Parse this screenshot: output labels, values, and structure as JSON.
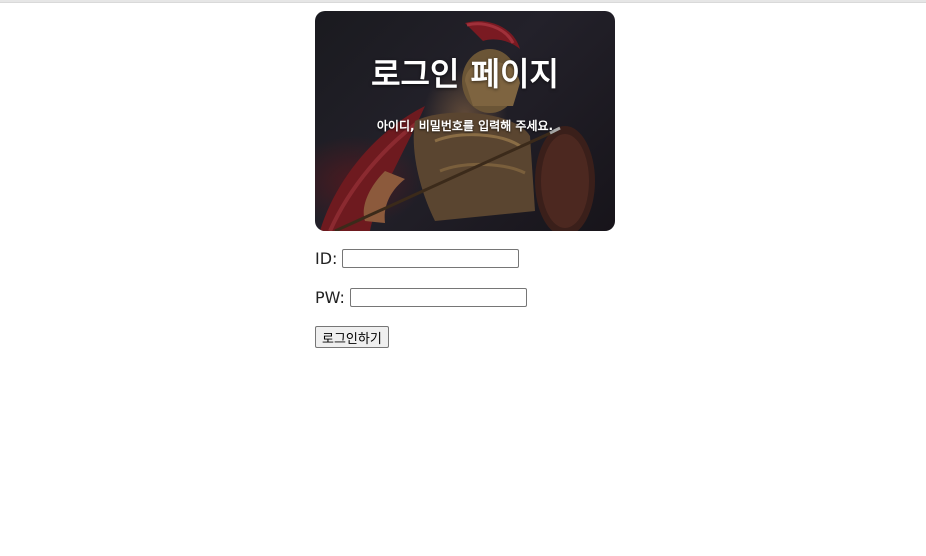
{
  "hero": {
    "title": "로그인 페이지",
    "subtitle": "아이디, 비밀번호를 입력해 주세요.",
    "image_semantic": "spartan-warrior-photo"
  },
  "form": {
    "id_label": "ID:",
    "id_value": "",
    "pw_label": "PW:",
    "pw_value": "",
    "submit_label": "로그인하기"
  }
}
